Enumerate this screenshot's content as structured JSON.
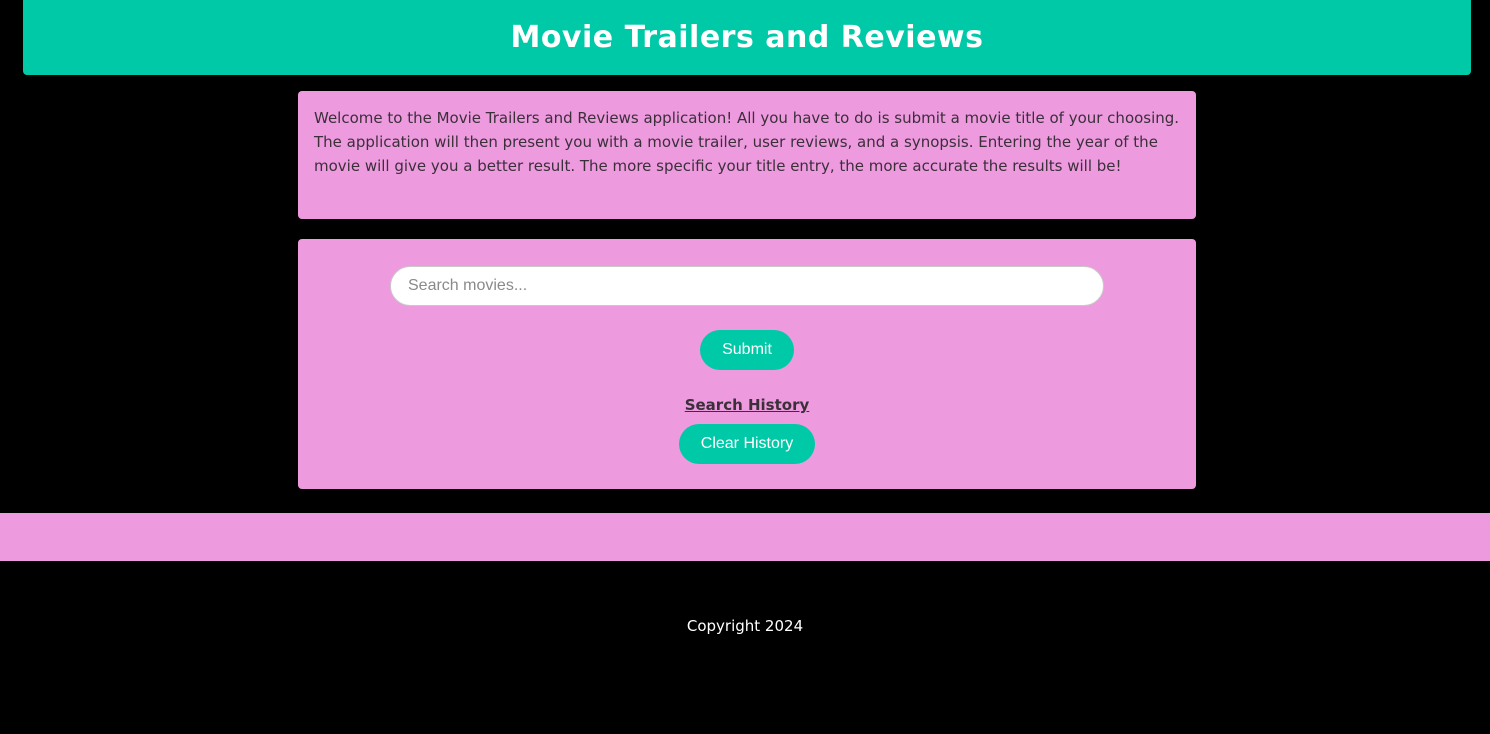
{
  "header": {
    "title": "Movie Trailers and Reviews"
  },
  "intro": {
    "text": "Welcome to the Movie Trailers and Reviews application! All you have to do is submit a movie title of your choosing. The application will then present you with a movie trailer, user reviews, and a synopsis. Entering the year of the movie will give you a better result. The more specific your title entry, the more accurate the results will be!"
  },
  "search": {
    "placeholder": "Search movies...",
    "value": "",
    "submit_label": "Submit"
  },
  "history": {
    "title": "Search History",
    "clear_label": "Clear History"
  },
  "footer": {
    "copyright": "Copyright 2024"
  },
  "colors": {
    "accent": "#00c9a7",
    "panel": "#ed9ade",
    "background": "#000000"
  }
}
